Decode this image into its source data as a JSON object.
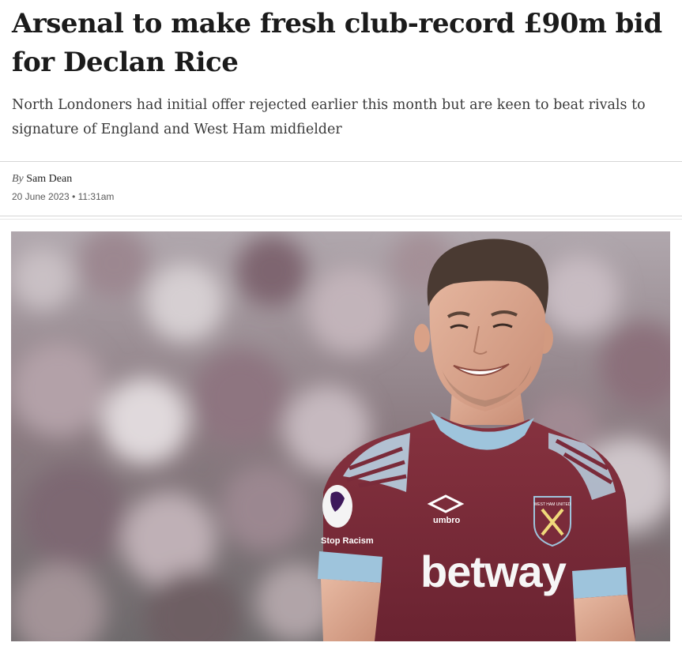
{
  "article": {
    "headline": "Arsenal to make fresh club-record £90m bid for Declan Rice",
    "standfirst": "North Londoners had initial offer rejected earlier this month but are keen to beat rivals to signature of England and West Ham midfielder",
    "byline_prefix": "By",
    "author": "Sam Dean",
    "dateline": "20 June 2023 • 11:31am"
  },
  "image": {
    "sponsor": "betway",
    "kit_brand": "umbro",
    "badge_text": "WEST HAM UNITED",
    "sleeve_text": "Stop Racism"
  },
  "colors": {
    "claret": "#7a2b3a",
    "sky_blue": "#9ec4dc",
    "text": "#1b1b1b"
  }
}
